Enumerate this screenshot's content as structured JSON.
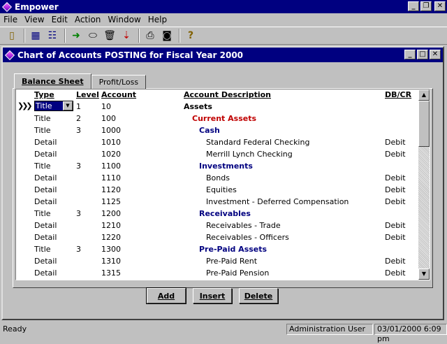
{
  "app": {
    "title": "Empower"
  },
  "menu": [
    "File",
    "View",
    "Edit",
    "Action",
    "Window",
    "Help"
  ],
  "toolbar": {
    "icons": [
      "exit-icon",
      "grid-icon",
      "tree-icon",
      "go-icon",
      "eraser-icon",
      "trash-icon",
      "sort-icon",
      "print-icon",
      "camera-icon",
      "help-icon"
    ]
  },
  "child": {
    "title": "Chart of Accounts POSTING for Fiscal Year 2000"
  },
  "tabs": [
    {
      "label": "Balance Sheet",
      "active": true
    },
    {
      "label": "Profit/Loss",
      "active": false
    }
  ],
  "grid": {
    "columns": {
      "type": "Type",
      "level": "Level",
      "account": "Account",
      "description": "Account Description",
      "dbcr": "DB/CR"
    },
    "selected_type": "Title",
    "rows": [
      {
        "type": "Title",
        "level": "1",
        "account": "10",
        "description": "Assets",
        "dbcr": "",
        "kind": "lvl1"
      },
      {
        "type": "Title",
        "level": "2",
        "account": "100",
        "description": "Current Assets",
        "dbcr": "",
        "kind": "lvl2"
      },
      {
        "type": "Title",
        "level": "3",
        "account": "1000",
        "description": "Cash",
        "dbcr": "",
        "kind": "lvl3"
      },
      {
        "type": "Detail",
        "level": "",
        "account": "1010",
        "description": "Standard Federal Checking",
        "dbcr": "Debit",
        "kind": "detail"
      },
      {
        "type": "Detail",
        "level": "",
        "account": "1020",
        "description": "Merrill Lynch Checking",
        "dbcr": "Debit",
        "kind": "detail"
      },
      {
        "type": "Title",
        "level": "3",
        "account": "1100",
        "description": "Investments",
        "dbcr": "",
        "kind": "lvl3"
      },
      {
        "type": "Detail",
        "level": "",
        "account": "1110",
        "description": "Bonds",
        "dbcr": "Debit",
        "kind": "detail"
      },
      {
        "type": "Detail",
        "level": "",
        "account": "1120",
        "description": "Equities",
        "dbcr": "Debit",
        "kind": "detail"
      },
      {
        "type": "Detail",
        "level": "",
        "account": "1125",
        "description": "Investment - Deferred Compensation",
        "dbcr": "Debit",
        "kind": "detail"
      },
      {
        "type": "Title",
        "level": "3",
        "account": "1200",
        "description": "Receivables",
        "dbcr": "",
        "kind": "lvl3"
      },
      {
        "type": "Detail",
        "level": "",
        "account": "1210",
        "description": "Receivables - Trade",
        "dbcr": "Debit",
        "kind": "detail"
      },
      {
        "type": "Detail",
        "level": "",
        "account": "1220",
        "description": "Receivables - Officers",
        "dbcr": "Debit",
        "kind": "detail"
      },
      {
        "type": "Title",
        "level": "3",
        "account": "1300",
        "description": "Pre-Paid Assets",
        "dbcr": "",
        "kind": "lvl3"
      },
      {
        "type": "Detail",
        "level": "",
        "account": "1310",
        "description": "Pre-Paid Rent",
        "dbcr": "Debit",
        "kind": "detail"
      },
      {
        "type": "Detail",
        "level": "",
        "account": "1315",
        "description": "Pre-Paid Pension",
        "dbcr": "Debit",
        "kind": "detail"
      }
    ]
  },
  "buttons": {
    "add": "Add",
    "insert": "Insert",
    "delete": "Delete"
  },
  "status": {
    "text": "Ready",
    "user": "Administration User",
    "datetime": "03/01/2000 6:09 pm"
  }
}
